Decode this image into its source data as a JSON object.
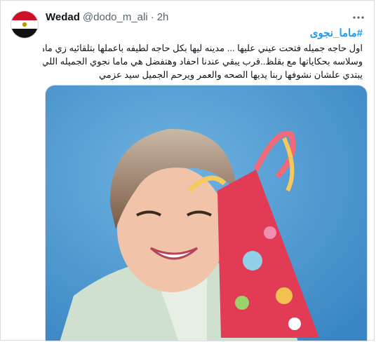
{
  "tweet": {
    "author_name": "Wedad",
    "author_handle": "@dodo_m_ali",
    "separator": "·",
    "time": "2h",
    "hashtag": "#ماما_نجوى",
    "lines": [
      "اول حاجه جميله فتحت عيني عليها ... مدينه ليها بكل حاجه لطيفه باعملها بتلقائيه زي ماهي علمتنا بلطافه",
      "وسلاسه بحكاياتها مع بقلظ..قرب يبقي عندنا احفاد وهتفضل هي ماما نجوي الجميله اللي كنا بنستني الارسال",
      "يبتدي علشان نشوفها ربنا يديها الصحه والعمر ويرحم الجميل سيد عزمي"
    ]
  },
  "icons": {
    "avatar": "egypt-flag-avatar",
    "more": "more-options-icon"
  },
  "colors": {
    "accent": "#1d9bf0",
    "image_bg": "#4b9ad4",
    "jacket": "#c8dcc8"
  }
}
